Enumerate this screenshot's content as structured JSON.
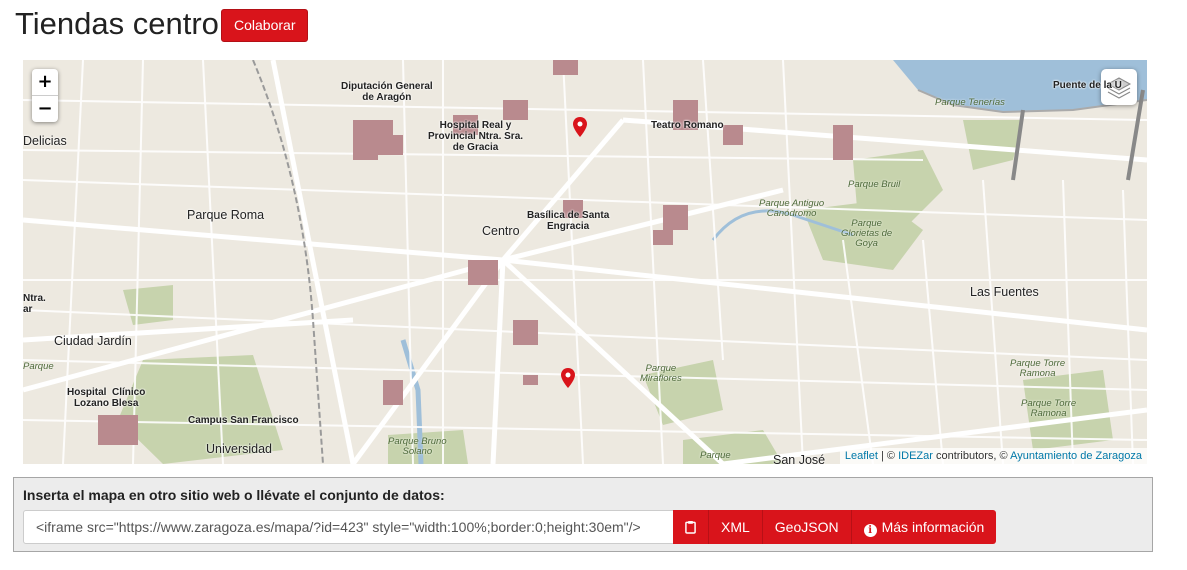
{
  "page": {
    "title": "Tiendas centro"
  },
  "header": {
    "collaborate_label": "Colaborar"
  },
  "map": {
    "zoom_in": "+",
    "zoom_out": "−",
    "attribution": {
      "leaflet": "Leaflet",
      "sep1": " | © ",
      "idezar": "IDEZar",
      "contributors": " contributors, © ",
      "ayto": "Ayuntamiento de Zaragoza"
    },
    "labels": {
      "delicias": "Delicias",
      "diputacion": "Diputación General\nde Aragón",
      "hospital_real": "Hospital Real y\nProvincial Ntra. Sra.\nde Gracia",
      "teatro": "Teatro Romano",
      "puente": "Puente de la U",
      "parque_tenerias": "Parque Tenerías",
      "parque_roma": "Parque Roma",
      "centro": "Centro",
      "basilica": "Basílica de Santa\nEngracia",
      "parque_bruil": "Parque Bruil",
      "parque_antiguo": "Parque Antiguo\nCanódromo",
      "parque_glorietas": "Parque\nGlorietas de\nGoya",
      "las_fuentes": "Las Fuentes",
      "ntra": "Ntra.\nar",
      "ciudad_jardin": "Ciudad Jardín",
      "parque_left": "Parque",
      "parque_miraflores": "Parque\nMiraflores",
      "torre_ramona_1": "Parque Torre\nRamona",
      "torre_ramona_2": "Parque Torre\nRamona",
      "hospital_clinico": "Hospital  Clínico\nLozano Blesa",
      "campus": "Campus San Francisco",
      "universidad": "Universidad",
      "parque_bruno": "Parque Bruno\nSolano",
      "parque_bottom": "Parque",
      "san_jose": "San José"
    }
  },
  "embed": {
    "title": "Inserta el mapa en otro sitio web o llévate el conjunto de datos:",
    "iframe_code": "<iframe src=\"https://www.zaragoza.es/mapa/?id=423\" style=\"width:100%;border:0;height:30em\"/>",
    "xml_label": "XML",
    "geojson_label": "GeoJSON",
    "more_info_label": "Más información",
    "info_glyph": "i"
  },
  "icons": {
    "copy": "clipboard-icon",
    "info": "info-circle-icon",
    "layers": "layers-icon",
    "marker": "map-marker-icon"
  },
  "colors": {
    "accent": "#d9141b",
    "map_bg": "#ede9e0",
    "park": "#c7d3ad",
    "water": "#9fbfd9",
    "building": "#b98a8e"
  }
}
